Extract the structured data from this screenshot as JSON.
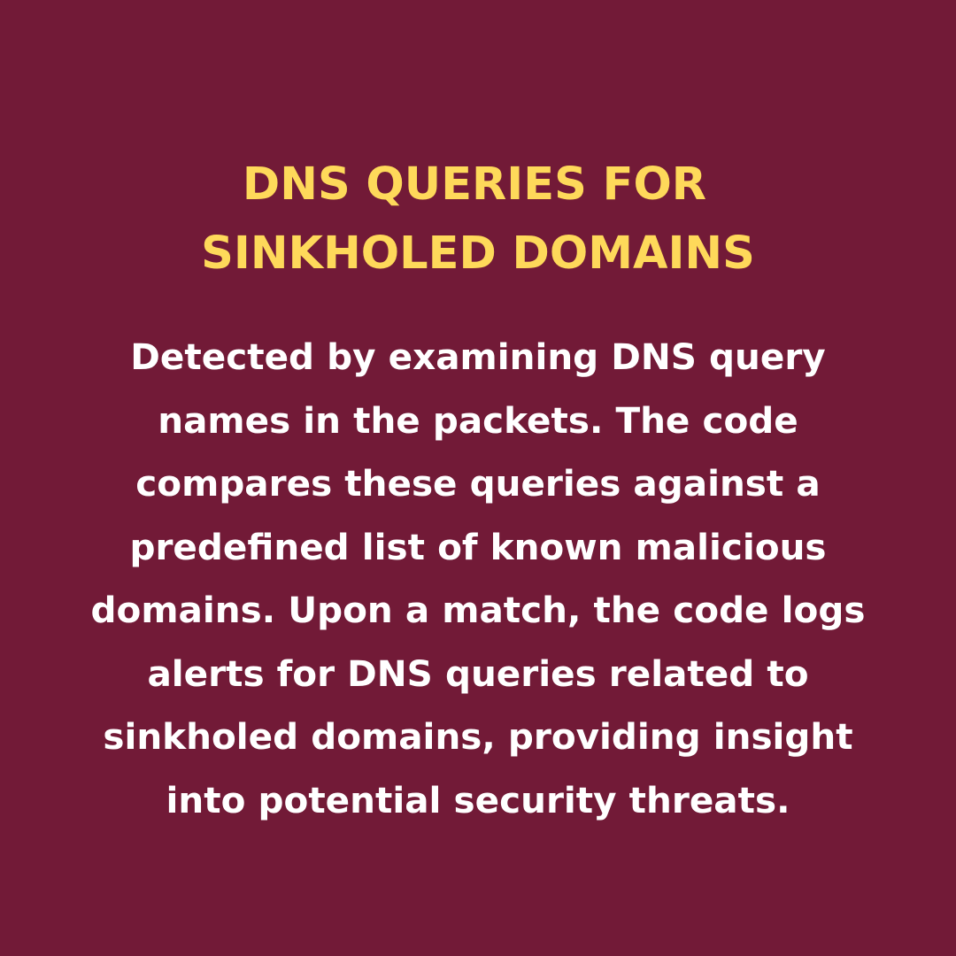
{
  "colors": {
    "background": "#721a37",
    "title": "#fed95a",
    "body": "#ffffff"
  },
  "title_lines": [
    "DNS QUERIES FOR",
    "SINKHOLED DOMAINS"
  ],
  "body_lines": [
    "Detected by examining DNS query",
    "names in the packets. The code",
    "compares these queries against a",
    "predefined list of known malicious",
    "domains. Upon a match, the code logs",
    "alerts for DNS queries related to",
    "sinkholed domains, providing insight",
    "into potential security threats."
  ]
}
